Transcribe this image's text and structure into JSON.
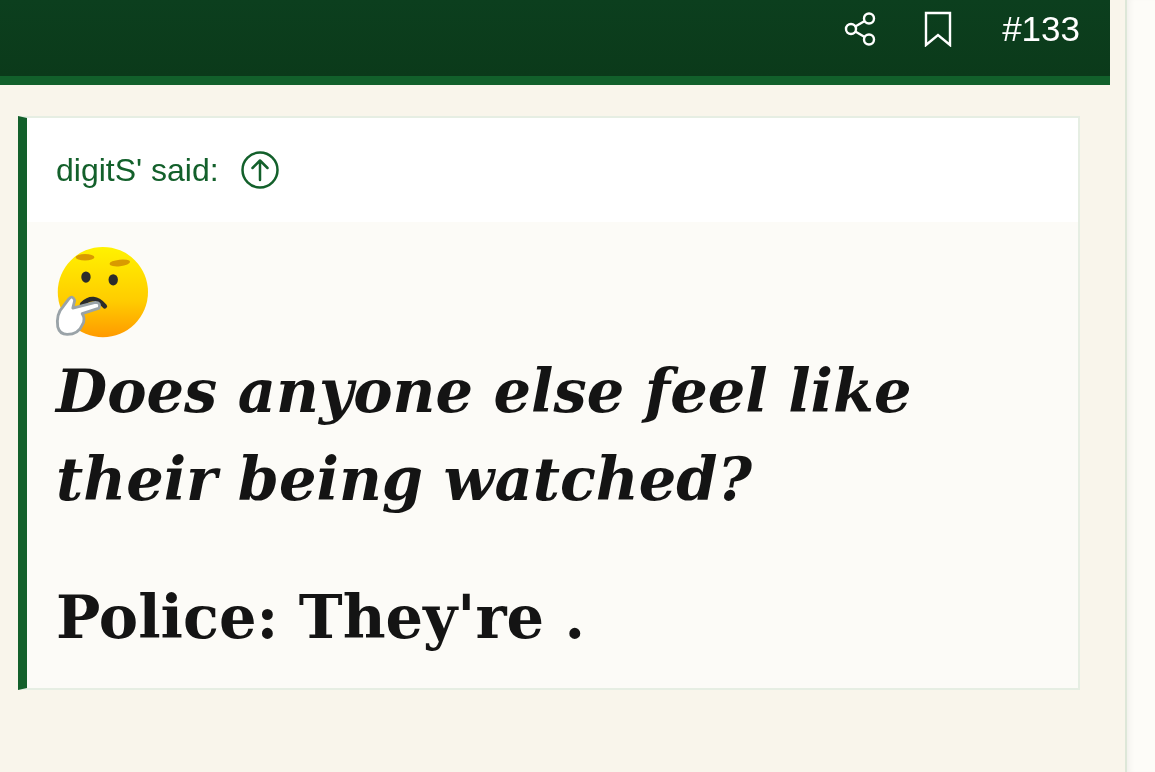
{
  "post_header": {
    "post_number": "#133"
  },
  "quote": {
    "author": "digitS' said:",
    "paragraphs": [
      {
        "kind": "italic",
        "text": "Does anyone else feel like their being watched?"
      },
      {
        "kind": "bold",
        "text": "Police: They're ."
      }
    ]
  }
}
